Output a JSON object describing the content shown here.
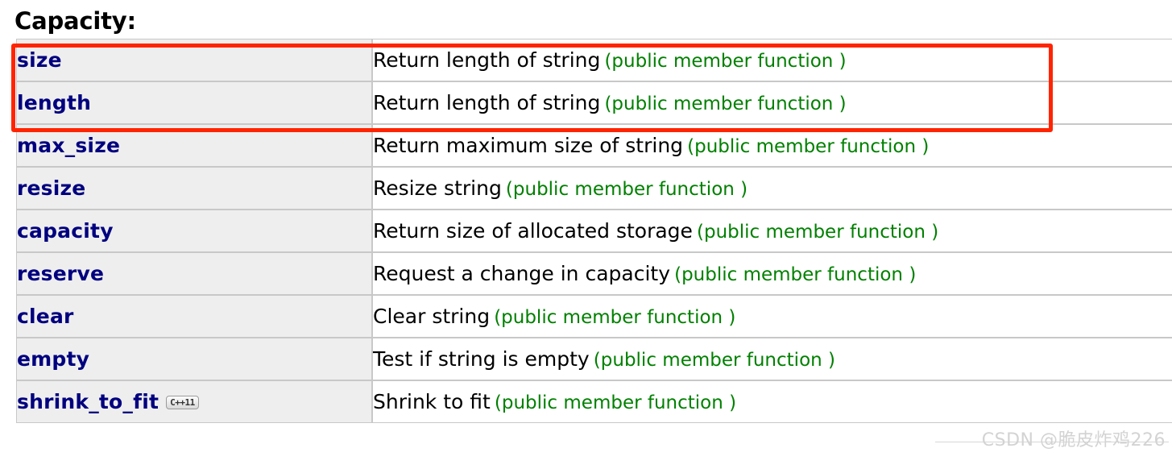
{
  "page": {
    "heading": "Capacity:",
    "watermark": "CSDN @脆皮炸鸡226"
  },
  "colors": {
    "member_name": "#00007f",
    "note": "#008000",
    "highlight_border": "#ff2400",
    "row_bg": "#eeeeee",
    "cell_border": "#c8c8c8"
  },
  "highlight": {
    "rows": [
      "size",
      "length"
    ],
    "note": "red annotation rectangle around the first two rows"
  },
  "table": {
    "rows": [
      {
        "name": "size",
        "badge": null,
        "description": "Return length of string",
        "note": "(public member function )"
      },
      {
        "name": "length",
        "badge": null,
        "description": "Return length of string",
        "note": "(public member function )"
      },
      {
        "name": "max_size",
        "badge": null,
        "description": "Return maximum size of string",
        "note": "(public member function )"
      },
      {
        "name": "resize",
        "badge": null,
        "description": "Resize string",
        "note": "(public member function )"
      },
      {
        "name": "capacity",
        "badge": null,
        "description": "Return size of allocated storage",
        "note": "(public member function )"
      },
      {
        "name": "reserve",
        "badge": null,
        "description": "Request a change in capacity",
        "note": "(public member function )"
      },
      {
        "name": "clear",
        "badge": null,
        "description": "Clear string",
        "note": "(public member function )"
      },
      {
        "name": "empty",
        "badge": null,
        "description": "Test if string is empty",
        "note": "(public member function )"
      },
      {
        "name": "shrink_to_fit",
        "badge": "C++11",
        "description": "Shrink to fit",
        "note": "(public member function )"
      }
    ]
  }
}
